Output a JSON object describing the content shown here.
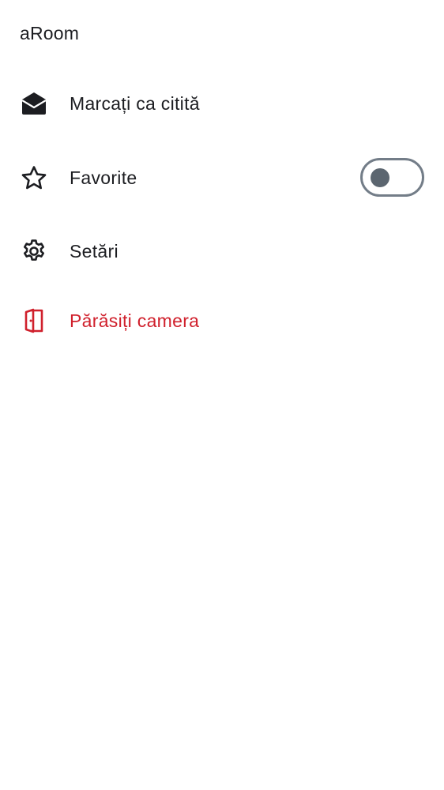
{
  "room": {
    "name": "aRoom"
  },
  "menu": {
    "mark_read": {
      "label": "Marcați ca citită",
      "icon": "envelope-open-icon"
    },
    "favourite": {
      "label": "Favorite",
      "icon": "star-icon",
      "toggle_on": false
    },
    "settings": {
      "label": "Setări",
      "icon": "gear-icon"
    },
    "leave": {
      "label": "Părăsiți camera",
      "icon": "leave-door-icon"
    }
  },
  "colors": {
    "text": "#1c1d21",
    "danger": "#d0202c",
    "toggle_border": "#737d88",
    "toggle_knob": "#5c6670",
    "background": "#ffffff"
  }
}
